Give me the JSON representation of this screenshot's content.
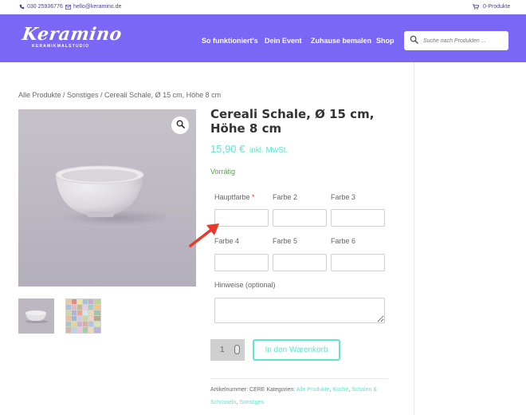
{
  "topbar": {
    "phone": "030 25936776",
    "email": "hello@keramino.de",
    "cart": "0-Produkte"
  },
  "header": {
    "logo": "Keramino",
    "logo_sub": "KERAMIKMALSTUDIO",
    "nav": [
      "So funktioniert's",
      "Dein Event",
      "Zuhause bemalen",
      "Shop"
    ],
    "search_placeholder": "Suche nach Produkten ..."
  },
  "breadcrumb": "Alle Produkte / Sonstiges / Cereali Schale, Ø 15 cm, Höhe 8 cm",
  "product": {
    "title": "Cereali Schale, Ø 15 cm, Höhe 8 cm",
    "price": "15,90 €",
    "tax": "inkl. MwSt.",
    "stock": "Vorrätig"
  },
  "form": {
    "color1": "Hauptfarbe",
    "required_mark": "*",
    "color2": "Farbe 2",
    "color3": "Farbe 3",
    "color4": "Farbe 4",
    "color5": "Farbe 5",
    "color6": "Farbe 6",
    "notes": "Hinweise (optional)"
  },
  "cart": {
    "quantity": "1",
    "add_label": "In den Warenkorb"
  },
  "meta": {
    "sku_label": "Artikelnummer:",
    "sku": "CERE",
    "categories_label": "Kategorien:",
    "categories": [
      "Alle Produkte",
      "Küche",
      "Schalen & Schüsseln",
      "Sonstiges"
    ]
  },
  "colors": {
    "brand": "#7a67f5",
    "accent": "#5ee6cf",
    "in_stock": "#5aa14d",
    "required": "#e2401c",
    "annotation_arrow": "#e8392b"
  }
}
